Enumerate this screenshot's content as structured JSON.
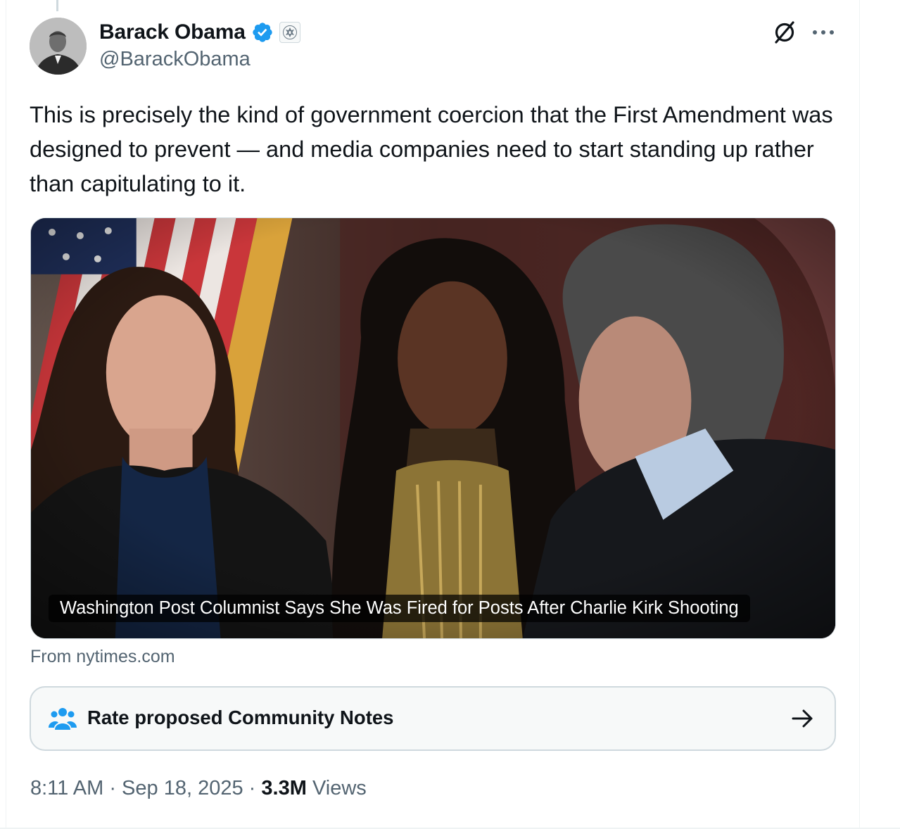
{
  "author": {
    "name": "Barack Obama",
    "handle": "@BarackObama",
    "verified_icon": "verified-badge-icon",
    "affiliation_icon": "us-government-seal-icon"
  },
  "header_actions": {
    "grok_icon": "grok-icon",
    "more_icon": "more-dots-icon"
  },
  "tweet": {
    "text": "This is precisely the kind of government coercion that the First Amendment was designed to prevent — and media companies need to start standing up rather than capitulating to it."
  },
  "link_card": {
    "headline": "Washington Post Columnist Says She Was Fired for Posts After Charlie Kirk Shooting",
    "source": "From nytimes.com"
  },
  "community_notes": {
    "label": "Rate proposed Community Notes",
    "icon": "people-group-icon",
    "arrow_icon": "arrow-right-icon"
  },
  "meta": {
    "time": "8:11 AM",
    "date": "Sep 18, 2025",
    "separator": "·",
    "views_count": "3.3M",
    "views_label": "Views"
  },
  "colors": {
    "text_primary": "#0f1419",
    "text_secondary": "#536471",
    "verified_blue": "#1d9bf0",
    "border": "#cfd9de"
  }
}
